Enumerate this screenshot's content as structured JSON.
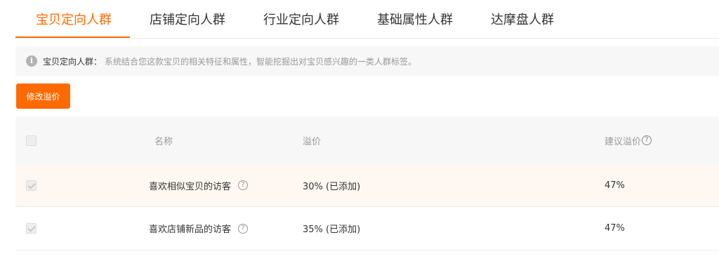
{
  "tabs": [
    {
      "label": "宝贝定向人群",
      "active": true
    },
    {
      "label": "店铺定向人群",
      "active": false
    },
    {
      "label": "行业定向人群",
      "active": false
    },
    {
      "label": "基础属性人群",
      "active": false
    },
    {
      "label": "达摩盘人群",
      "active": false
    }
  ],
  "notice": {
    "icon": "info-icon",
    "title": "宝贝定向人群",
    "colon": "：",
    "description": "系统结合您这款宝贝的相关特征和属性，智能挖掘出对宝贝感兴趣的一类人群标签。"
  },
  "toolbar": {
    "modify_label": "修改溢价"
  },
  "table": {
    "headers": {
      "name": "名称",
      "premium": "溢价",
      "suggested": "建议溢价"
    },
    "help_glyph": "?",
    "rows": [
      {
        "name": "喜欢相似宝贝的访客",
        "premium": "30% (已添加)",
        "suggested": "47%",
        "checked": true
      },
      {
        "name": "喜欢店铺新品的访客",
        "premium": "35% (已添加)",
        "suggested": "47%",
        "checked": true
      }
    ]
  },
  "colors": {
    "accent": "#ff6a00",
    "notice_bg": "#f7f7f7",
    "row_highlight": "#fff8f2"
  }
}
